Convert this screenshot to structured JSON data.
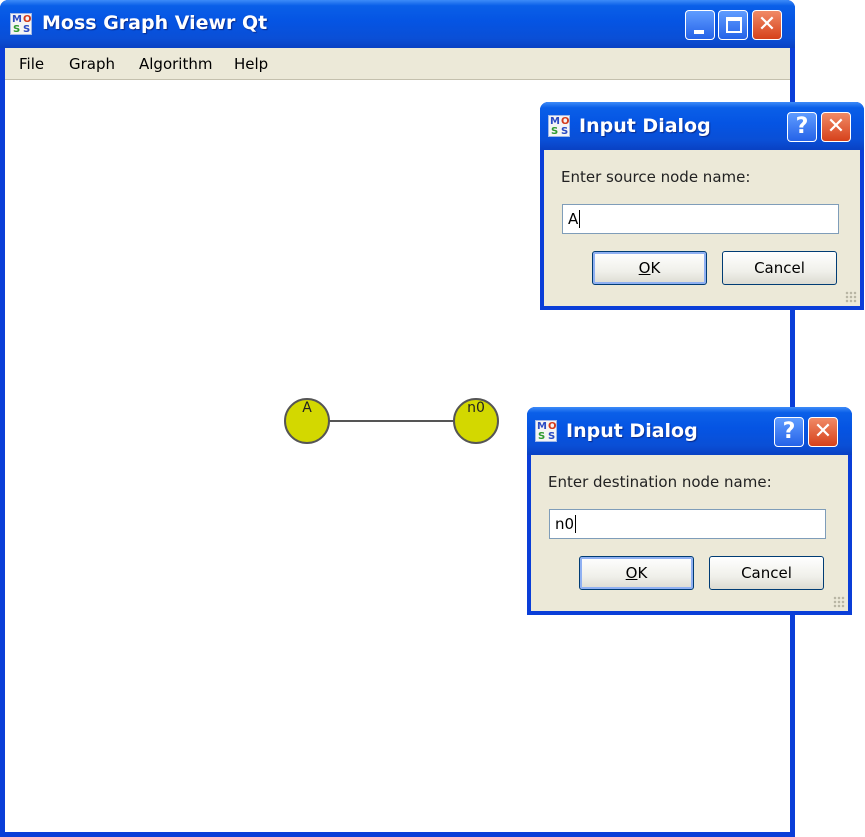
{
  "main_window": {
    "title": "Moss Graph Viewr Qt",
    "icon": "moss-app-icon",
    "icon_letters": [
      "M",
      "O",
      "S",
      "S"
    ],
    "controls": {
      "minimize": "minimize-icon",
      "maximize": "maximize-icon",
      "close": "✕"
    },
    "menu": [
      "File",
      "Graph",
      "Algorithm",
      "Help"
    ]
  },
  "graph": {
    "nodes": [
      {
        "label": "A"
      },
      {
        "label": "n0"
      }
    ],
    "edges": [
      {
        "from": "A",
        "to": "n0"
      }
    ],
    "node_color": "#d3d800",
    "edge_color": "#555555"
  },
  "dialogs": [
    {
      "title": "Input Dialog",
      "help": "?",
      "close": "✕",
      "prompt": "Enter source node name:",
      "value": "A",
      "ok_first": "O",
      "ok_rest": "K",
      "cancel": "Cancel"
    },
    {
      "title": "Input Dialog",
      "help": "?",
      "close": "✕",
      "prompt": "Enter destination node name:",
      "value": "n0",
      "ok_first": "O",
      "ok_rest": "K",
      "cancel": "Cancel"
    }
  ],
  "colors": {
    "titlebar_blue": "#0554e3",
    "window_face": "#ece9d8",
    "close_red": "#d6411b"
  }
}
